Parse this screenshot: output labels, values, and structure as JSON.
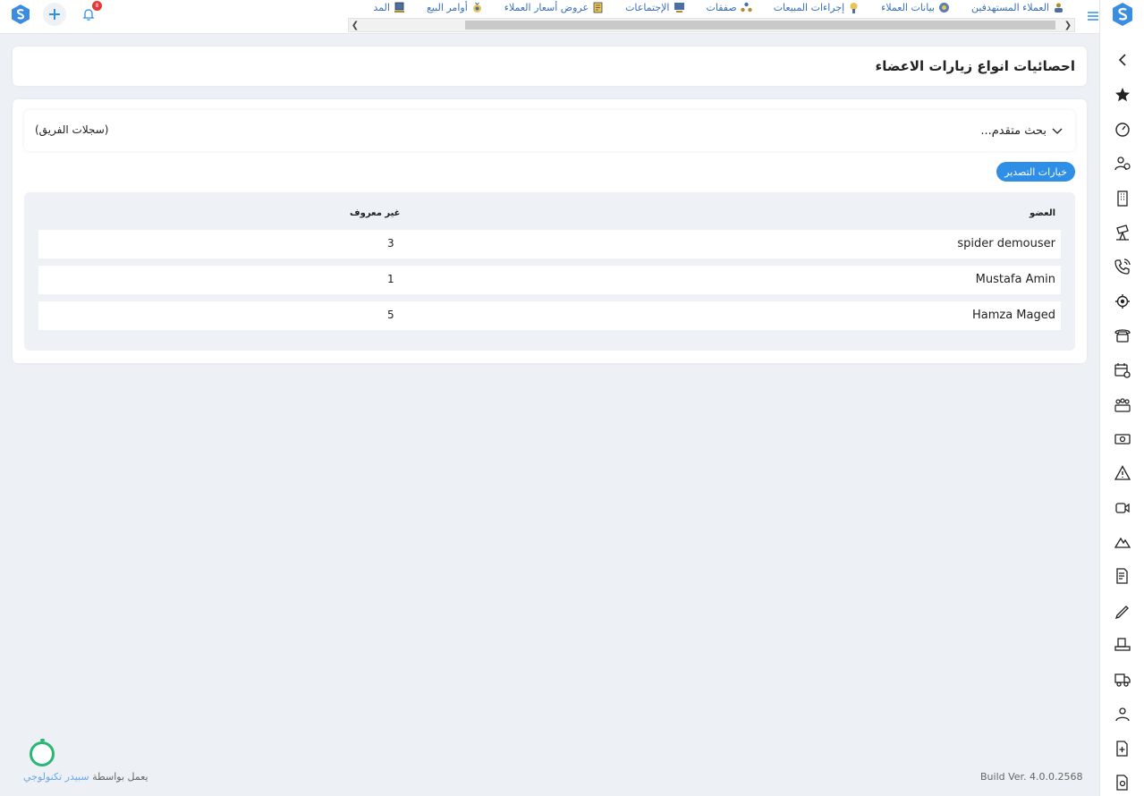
{
  "nav": {
    "items": [
      {
        "label": "العملاء المستهدفين",
        "icon": "target-customers-icon"
      },
      {
        "label": "بيانات العملاء",
        "icon": "customer-data-icon"
      },
      {
        "label": "إجراءات المبيعات",
        "icon": "sales-actions-icon"
      },
      {
        "label": "صفقات",
        "icon": "deals-icon"
      },
      {
        "label": "الإجتماعات",
        "icon": "meetings-icon"
      },
      {
        "label": "عروض أسعار العملاء",
        "icon": "quotations-icon"
      },
      {
        "label": "أوامر البيع",
        "icon": "sales-orders-icon"
      },
      {
        "label": "المد",
        "icon": "laptop-icon"
      }
    ],
    "notification_count": "8"
  },
  "page": {
    "title": "احصائيات انواع زيارات الاعضاء"
  },
  "search": {
    "advanced_label": "بحث متقدم...",
    "team_records": "(سجلات الفريق)"
  },
  "export_label": "خيارات التصدير",
  "table": {
    "headers": {
      "member": "العضو",
      "unknown": "غير معروف"
    },
    "rows": [
      {
        "member": "spider demouser",
        "unknown": "3"
      },
      {
        "member": "Mustafa Amin",
        "unknown": "1"
      },
      {
        "member": "Hamza Maged",
        "unknown": "5"
      }
    ]
  },
  "footer": {
    "powered_by": "يعمل بواسطة",
    "brand": "سبيدر تكنولوجي",
    "build": "Build Ver. 4.0.0.2568"
  },
  "colors": {
    "accent": "#2f8fe6",
    "background": "#edf1f6",
    "chat": "#2bb673"
  }
}
